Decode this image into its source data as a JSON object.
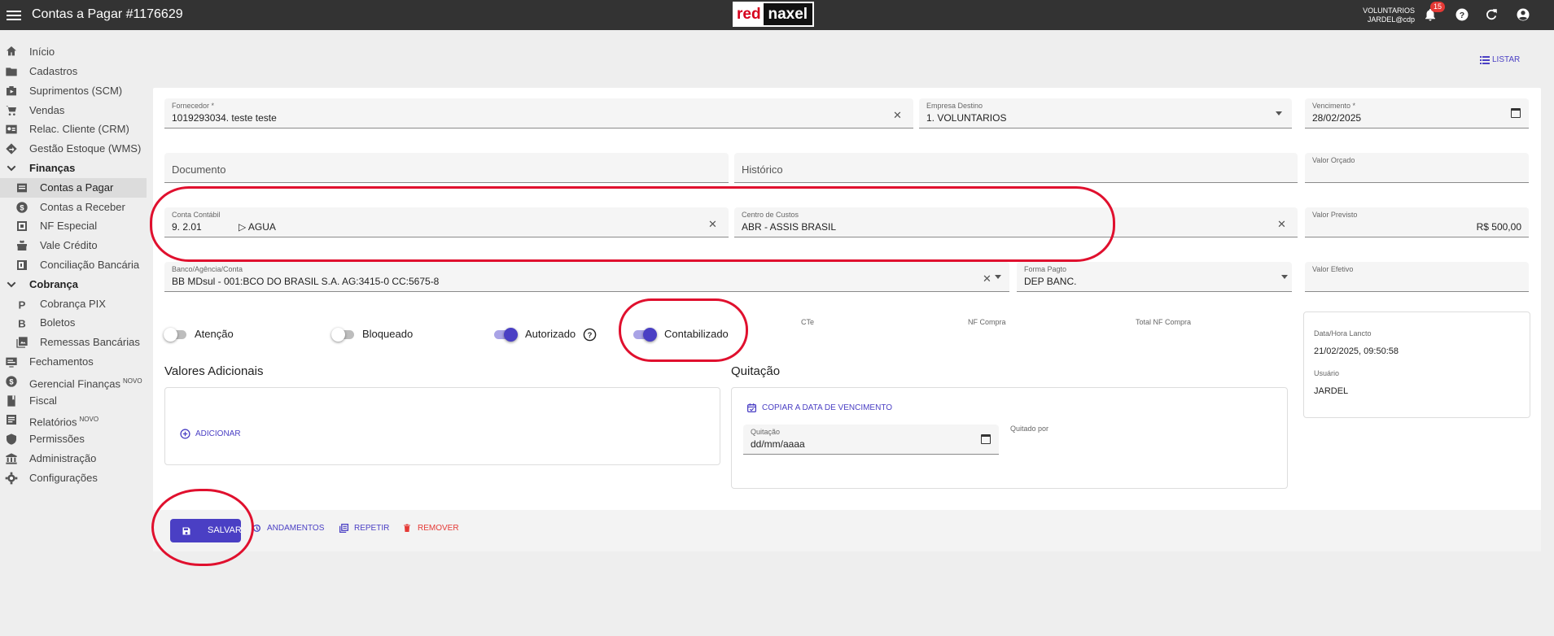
{
  "header": {
    "title": "Contas a Pagar #1176629",
    "logo_left": "red",
    "logo_right": "naxel",
    "user_org": "VOLUNTARIOS",
    "user_name": "JARDEL@cdp",
    "notifications": "15",
    "icons": [
      "menu-icon",
      "bell-icon",
      "help-icon",
      "refresh-icon",
      "account-icon"
    ]
  },
  "sidebar": {
    "items": [
      {
        "label": "Início",
        "icon": "home-icon"
      },
      {
        "label": "Cadastros",
        "icon": "folder-icon"
      },
      {
        "label": "Suprimentos (SCM)",
        "icon": "supply-icon"
      },
      {
        "label": "Vendas",
        "icon": "cart-icon"
      },
      {
        "label": "Relac. Cliente (CRM)",
        "icon": "contact-card-icon"
      },
      {
        "label": "Gestão Estoque (WMS)",
        "icon": "warehouse-icon"
      },
      {
        "label": "Finanças",
        "icon": "chevron-down-icon"
      },
      {
        "label": "Contas a Pagar",
        "icon": "list-icon"
      },
      {
        "label": "Contas a Receber",
        "icon": "dollar-icon"
      },
      {
        "label": "NF Especial",
        "icon": "nf-icon"
      },
      {
        "label": "Vale Crédito",
        "icon": "gift-icon"
      },
      {
        "label": "Conciliação Bancária",
        "icon": "reconcile-icon"
      },
      {
        "label": "Cobrança",
        "icon": "chevron-down-icon"
      },
      {
        "label": "Cobrança PIX",
        "icon": "p-icon"
      },
      {
        "label": "Boletos",
        "icon": "b-icon"
      },
      {
        "label": "Remessas Bancárias",
        "icon": "image-icon"
      },
      {
        "label": "Fechamentos",
        "icon": "screen-icon"
      },
      {
        "label": "Gerencial Finanças",
        "icon": "dollar-icon",
        "tag": "NOVO"
      },
      {
        "label": "Fiscal",
        "icon": "book-icon"
      },
      {
        "label": "Relatórios",
        "icon": "report-icon",
        "tag": "NOVO"
      },
      {
        "label": "Permissões",
        "icon": "shield-icon"
      },
      {
        "label": "Administração",
        "icon": "bank-icon"
      },
      {
        "label": "Configurações",
        "icon": "gear-icon"
      }
    ]
  },
  "actions": {
    "list_label": "LISTAR"
  },
  "form": {
    "fornecedor": {
      "label": "Fornecedor *",
      "value": "1019293034. teste teste"
    },
    "empresa": {
      "label": "Empresa Destino",
      "value": "1. VOLUNTARIOS"
    },
    "vencimento": {
      "label": "Vencimento *",
      "value": "28/02/2025"
    },
    "documento": {
      "placeholder": "Documento"
    },
    "historico": {
      "placeholder": "Histórico"
    },
    "valor_orcado": {
      "label": "Valor Orçado",
      "value": ""
    },
    "conta_contabil": {
      "label": "Conta Contábil",
      "code": "9. 2.01",
      "name": "▷ AGUA"
    },
    "centro_custos": {
      "label": "Centro de Custos",
      "value": "ABR - ASSIS BRASIL"
    },
    "valor_previsto": {
      "label": "Valor Previsto",
      "value": "R$ 500,00"
    },
    "banco": {
      "label": "Banco/Agência/Conta",
      "value": "BB MDsul - 001:BCO DO BRASIL S.A. AG:3415-0 CC:5675-8"
    },
    "forma_pagto": {
      "label": "Forma Pagto",
      "value": "DEP BANC."
    },
    "valor_efetivo": {
      "label": "Valor Efetivo",
      "value": ""
    }
  },
  "toggles": {
    "atencao": {
      "label": "Atenção",
      "on": false
    },
    "bloqueado": {
      "label": "Bloqueado",
      "on": false
    },
    "autorizado": {
      "label": "Autorizado",
      "on": true
    },
    "contabilizado": {
      "label": "Contabilizado",
      "on": true
    }
  },
  "info_labels": {
    "cte": "CTe",
    "nf_compra": "NF Compra",
    "total_nf": "Total NF Compra"
  },
  "audit": {
    "date_label": "Data/Hora Lancto",
    "date_value": "21/02/2025, 09:50:58",
    "user_label": "Usuário",
    "user_value": "JARDEL"
  },
  "valores": {
    "title": "Valores Adicionais",
    "add_label": "ADICIONAR"
  },
  "quitacao": {
    "title": "Quitação",
    "copy_label": "COPIAR A DATA DE VENCIMENTO",
    "field_label": "Quitação",
    "field_value": "dd/mm/aaaa",
    "quitado_por": "Quitado por"
  },
  "footer": {
    "save": "SALVAR",
    "andamentos": "ANDAMENTOS",
    "repetir": "REPETIR",
    "remover": "REMOVER"
  },
  "colors": {
    "accent": "#4a3fc4",
    "danger": "#e53935",
    "annotation": "#e0102e",
    "topbar": "#333333"
  }
}
